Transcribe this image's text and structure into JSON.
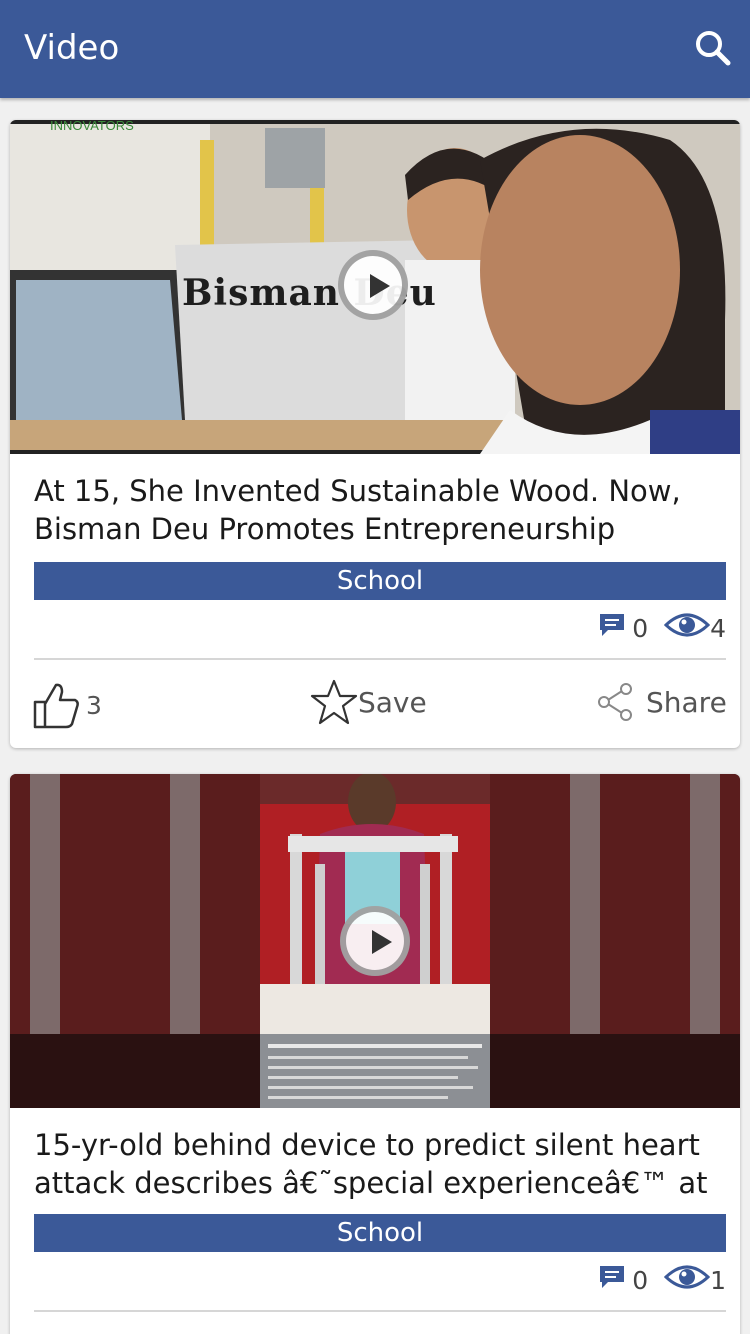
{
  "app": {
    "title": "Video"
  },
  "search": {
    "icon": "search-icon"
  },
  "colors": {
    "brand": "#3b5998"
  },
  "videos": [
    {
      "overlay_text": "Bisman Deu",
      "watermark": "INNOVATORS",
      "title": "At 15, She Invented Sustainable Wood. Now, Bisman Deu Promotes Entrepreneurship",
      "category": "School",
      "comments": "0",
      "views": "4",
      "likes": "3",
      "save_label": "Save",
      "share_label": "Share"
    },
    {
      "title": "15-yr-old behind device to predict silent heart attack describes â€˜special experienceâ€™ at",
      "category": "School",
      "comments": "0",
      "views": "1"
    }
  ]
}
